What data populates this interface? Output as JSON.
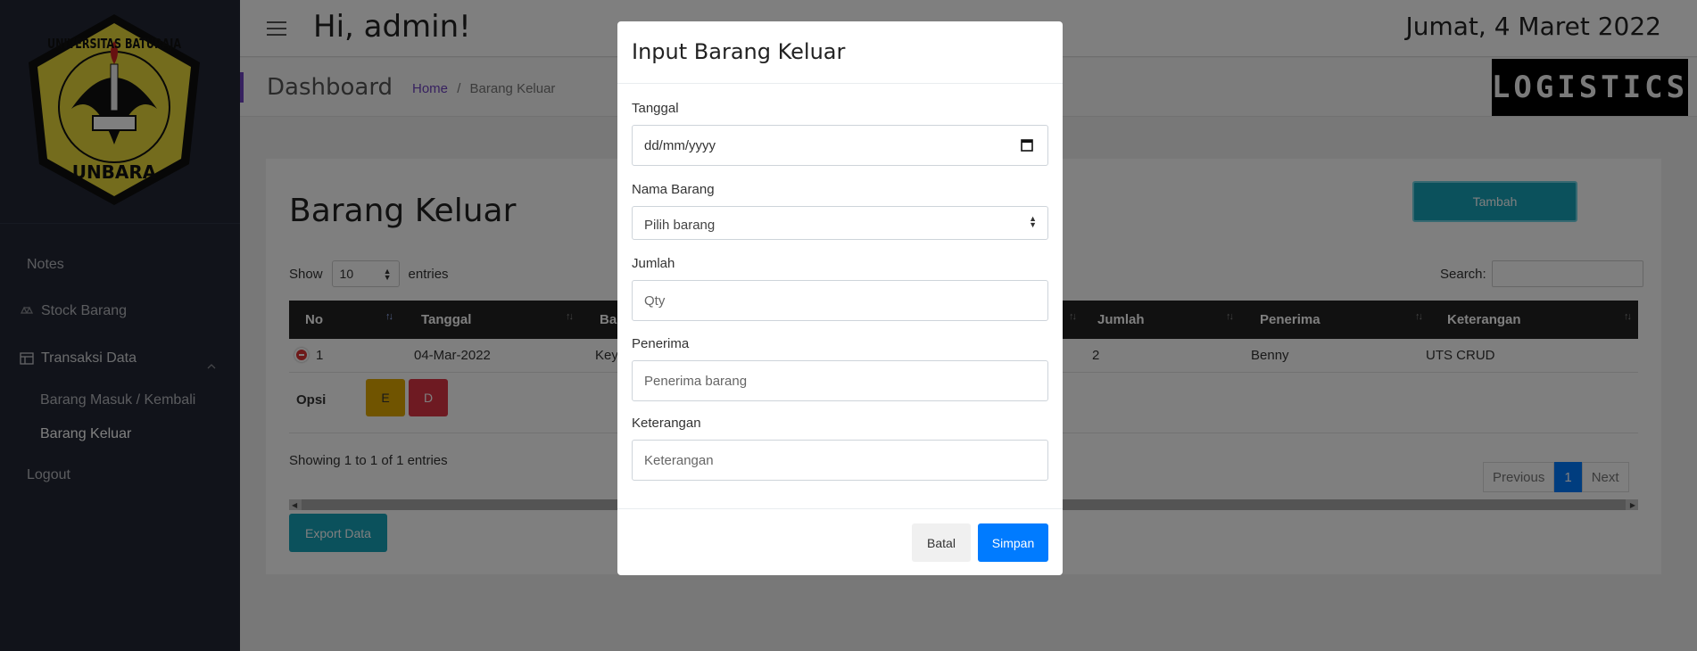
{
  "topbar": {
    "greeting": "Hi, admin!",
    "date": "Jumat, 4 Maret 2022"
  },
  "header": {
    "title": "Dashboard",
    "breadcrumb": {
      "home": "Home",
      "sep": "/",
      "current": "Barang Keluar"
    },
    "brand": "LOGISTICS"
  },
  "sidebar": {
    "logo_top_text": "UNIVERSITAS BATURAJA",
    "logo_bottom_text": "UNBARA",
    "items": [
      {
        "label": "Notes"
      },
      {
        "label": "Stock Barang"
      },
      {
        "label": "Transaksi Data"
      },
      {
        "label": "Barang Masuk / Kembali"
      },
      {
        "label": "Barang Keluar"
      },
      {
        "label": "Logout"
      }
    ]
  },
  "card": {
    "title": "Barang Keluar",
    "add_button": "Tambah",
    "show_label": "Show",
    "show_value": "10",
    "entries_label": "entries",
    "search_label": "Search:",
    "columns": [
      "No",
      "Tanggal",
      "Ba",
      "Jumlah",
      "Penerima",
      "Keterangan"
    ],
    "row": {
      "no": "1",
      "tanggal": "04-Mar-2022",
      "barang": "Keyl",
      "jumlah": "2",
      "penerima": "Benny",
      "keterangan": "UTS CRUD"
    },
    "opsi_label": "Opsi",
    "edit_button": "E",
    "delete_button": "D",
    "showing": "Showing 1 to 1 of 1 entries",
    "pager": {
      "prev": "Previous",
      "page": "1",
      "next": "Next"
    },
    "export_button": "Export Data"
  },
  "modal": {
    "title": "Input Barang Keluar",
    "tanggal_label": "Tanggal",
    "tanggal_placeholder": "dd/mm/yyyy",
    "nama_label": "Nama Barang",
    "nama_value": "Pilih barang",
    "jumlah_label": "Jumlah",
    "jumlah_placeholder": "Qty",
    "penerima_label": "Penerima",
    "penerima_placeholder": "Penerima barang",
    "keterangan_label": "Keterangan",
    "keterangan_placeholder": "Keterangan",
    "cancel_button": "Batal",
    "save_button": "Simpan"
  },
  "colors": {
    "sidebar_bg": "#232735",
    "accent": "#17a2b8",
    "primary": "#007bff",
    "warning": "#e0a800",
    "danger": "#dc3545"
  }
}
